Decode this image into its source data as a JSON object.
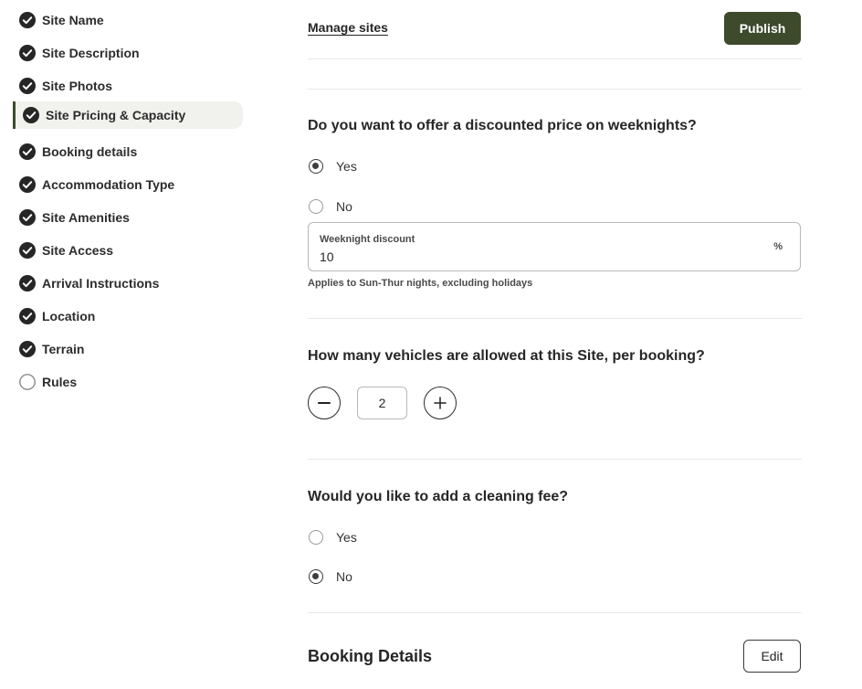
{
  "sidebar": {
    "items": [
      {
        "label": "Site Name",
        "status": "complete"
      },
      {
        "label": "Site Description",
        "status": "complete"
      },
      {
        "label": "Site Photos",
        "status": "complete"
      },
      {
        "label": "Site Pricing & Capacity",
        "status": "complete",
        "active": true
      },
      {
        "label": "Booking details",
        "status": "complete"
      },
      {
        "label": "Accommodation Type",
        "status": "complete"
      },
      {
        "label": "Site Amenities",
        "status": "complete"
      },
      {
        "label": "Site Access",
        "status": "complete"
      },
      {
        "label": "Arrival Instructions",
        "status": "complete"
      },
      {
        "label": "Location",
        "status": "complete"
      },
      {
        "label": "Terrain",
        "status": "complete"
      },
      {
        "label": "Rules",
        "status": "incomplete"
      }
    ]
  },
  "header": {
    "manage_sites": "Manage sites",
    "publish": "Publish"
  },
  "weeknight": {
    "question": "Do you want to offer a discounted price on weeknights?",
    "options": [
      {
        "label": "Yes",
        "checked": true
      },
      {
        "label": "No",
        "checked": false
      }
    ],
    "field_label": "Weeknight discount",
    "field_value": "10",
    "field_suffix": "%",
    "hint": "Applies to Sun-Thur nights, excluding holidays"
  },
  "vehicles": {
    "question": "How many vehicles are allowed at this Site, per booking?",
    "value": "2",
    "decrement_icon": "minus-icon",
    "increment_icon": "plus-icon"
  },
  "cleaning": {
    "question": "Would you like to add a cleaning fee?",
    "options": [
      {
        "label": "Yes",
        "checked": false
      },
      {
        "label": "No",
        "checked": true
      }
    ]
  },
  "booking_details": {
    "title": "Booking Details",
    "edit": "Edit"
  },
  "colors": {
    "brand": "#3d4a2c",
    "check": "#262626",
    "active_bg": "#f1f1ed"
  }
}
